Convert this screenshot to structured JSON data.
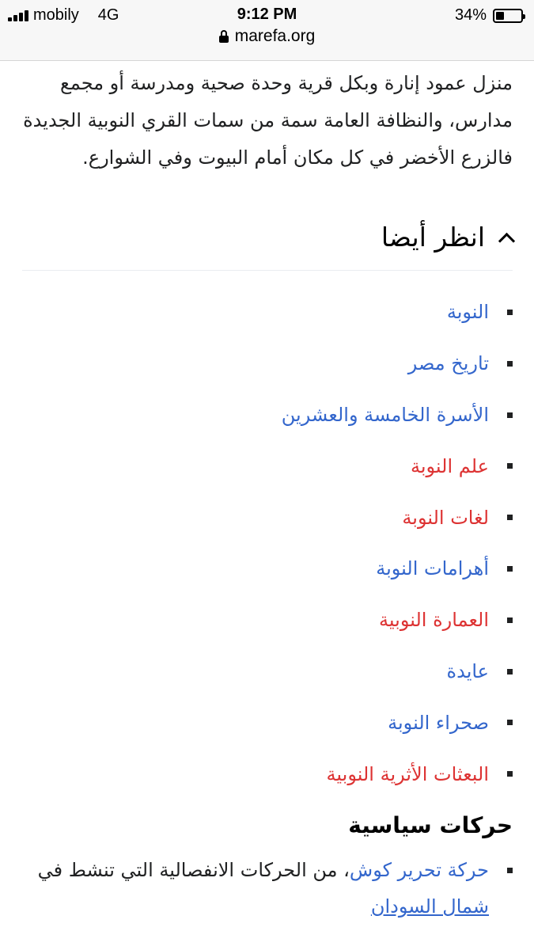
{
  "status_bar": {
    "carrier": "mobily",
    "network": "4G",
    "time": "9:12 PM",
    "battery_percent": "34%",
    "battery_level": 0.34
  },
  "url_bar": {
    "domain": "marefa.org"
  },
  "article": {
    "paragraph": "منزل عمود إنارة وبكل قرية وحدة صحية ومدرسة أو مجمع مدارس، والنظافة العامة سمة من سمات القري النوبية الجديدة فالزرع الأخضر في كل مكان أمام البيوت وفي الشوارع.",
    "see_also": {
      "title": "انظر أيضا",
      "items": [
        {
          "label": "النوبة",
          "link_color": "#3366cc"
        },
        {
          "label": "تاريخ مصر",
          "link_color": "#3366cc"
        },
        {
          "label": "الأسرة الخامسة والعشرين",
          "link_color": "#3366cc"
        },
        {
          "label": "علم النوبة",
          "link_color": "#dd3333"
        },
        {
          "label": "لغات النوبة",
          "link_color": "#dd3333"
        },
        {
          "label": "أهرامات النوبة",
          "link_color": "#3366cc"
        },
        {
          "label": "العمارة النوبية",
          "link_color": "#dd3333"
        },
        {
          "label": "عايدة",
          "link_color": "#3366cc"
        },
        {
          "label": "صحراء النوبة",
          "link_color": "#3366cc"
        },
        {
          "label": "البعثات الأثرية النوبية",
          "link_color": "#dd3333"
        }
      ]
    },
    "political_movements": {
      "title": "حركات سياسية",
      "items": [
        {
          "link_label": "حركة تحرير كوش",
          "text": "، من الحركات الانفصالية التي تنشط في",
          "link2_label": "شمال السودان"
        }
      ]
    }
  },
  "colors": {
    "link_blue": "#3366cc",
    "link_red": "#dd3333",
    "text": "#202122"
  }
}
